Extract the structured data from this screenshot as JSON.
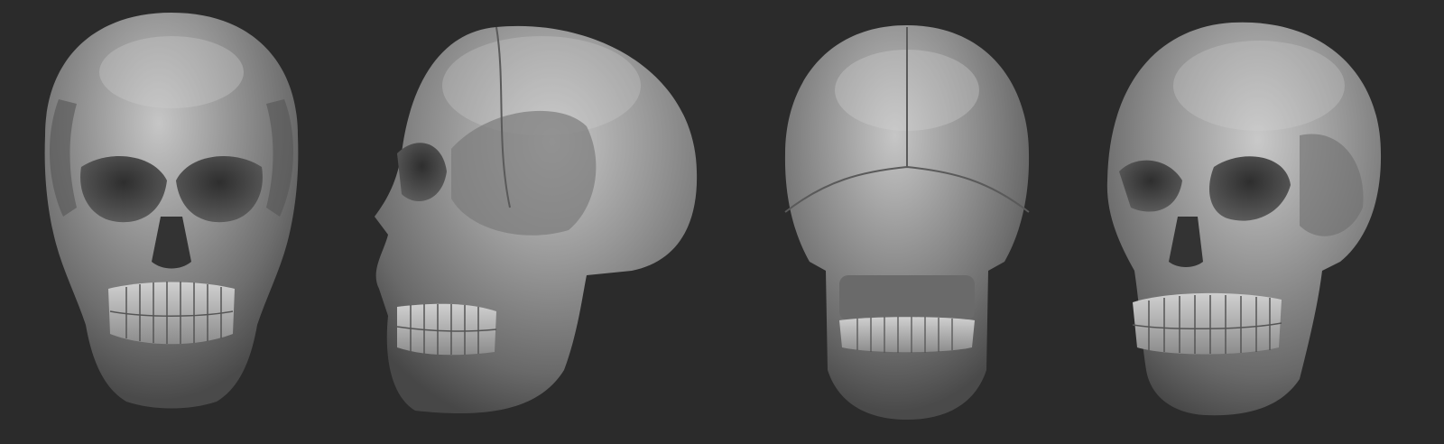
{
  "scene": {
    "background": "#2b2b2b",
    "material": "#8a8a8a",
    "views": [
      {
        "name": "front-view"
      },
      {
        "name": "side-view"
      },
      {
        "name": "back-view"
      },
      {
        "name": "three-quarter-view"
      }
    ]
  }
}
